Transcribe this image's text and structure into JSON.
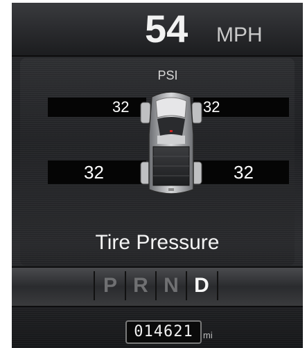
{
  "speed": {
    "value": "54",
    "unit": "MPH"
  },
  "tpms": {
    "unit_label": "PSI",
    "front_left": "32",
    "front_right": "32",
    "rear_left": "32",
    "rear_right": "32",
    "title": "Tire Pressure"
  },
  "gear": {
    "options": [
      "P",
      "R",
      "N",
      "D"
    ],
    "selected": "D"
  },
  "odometer": {
    "value": "014621",
    "unit": "mi"
  },
  "colors": {
    "background": "#1b1c1e",
    "text_primary": "#f2f2f2",
    "gear_inactive": "#6f7072",
    "gear_active": "#f6f6f6"
  }
}
